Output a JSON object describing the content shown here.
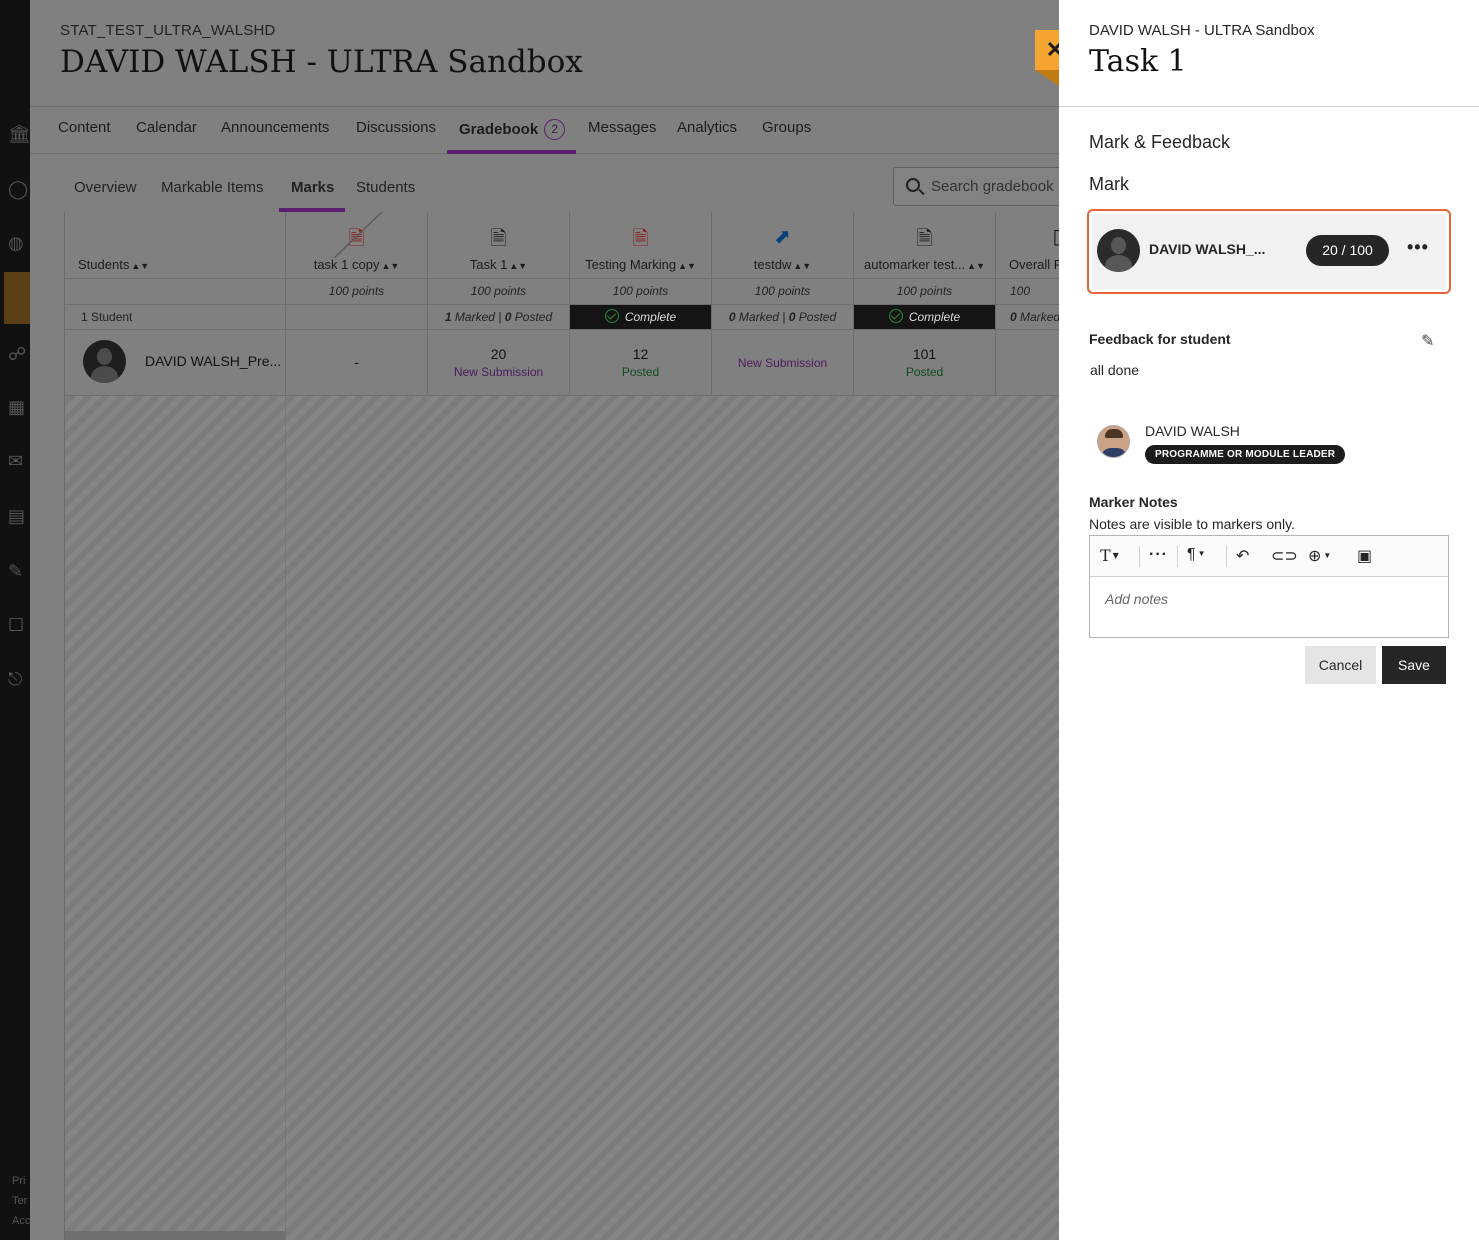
{
  "course": {
    "code": "STAT_TEST_ULTRA_WALSHD",
    "title": "DAVID WALSH - ULTRA Sandbox"
  },
  "top_tabs": [
    {
      "label": "Content"
    },
    {
      "label": "Calendar"
    },
    {
      "label": "Announcements"
    },
    {
      "label": "Discussions"
    },
    {
      "label": "Gradebook",
      "badge": "2",
      "active": true
    },
    {
      "label": "Messages"
    },
    {
      "label": "Analytics"
    },
    {
      "label": "Groups"
    }
  ],
  "sub_tabs": [
    {
      "label": "Overview"
    },
    {
      "label": "Markable Items"
    },
    {
      "label": "Marks",
      "active": true
    },
    {
      "label": "Students"
    }
  ],
  "search": {
    "placeholder": "Search gradebook"
  },
  "gradebook": {
    "students_header": "Students",
    "student_count": "1 Student",
    "columns": [
      {
        "title": "task 1 copy",
        "icon": "hidden-assignment-icon",
        "points": "100 points",
        "stat": "",
        "value": "-",
        "status": ""
      },
      {
        "title": "Task 1",
        "icon": "assignment-icon",
        "points": "100 points",
        "stat_marked": "1",
        "stat_posted": "0",
        "value": "20",
        "status": "New Submission"
      },
      {
        "title": "Testing Marking",
        "icon": "assignment-icon",
        "points": "100 points",
        "stat_complete": "Complete",
        "value": "12",
        "status": "Posted"
      },
      {
        "title": "testdw",
        "icon": "external-link-icon",
        "points": "100 points",
        "stat_marked": "0",
        "stat_posted": "0",
        "value": "",
        "status": "New Submission"
      },
      {
        "title": "automarker test...",
        "icon": "assignment-icon",
        "points": "100 points",
        "stat_complete": "Complete",
        "value": "101",
        "status": "Posted"
      },
      {
        "title": "Overall F",
        "icon": "grade-icon",
        "points": "100",
        "stat_marked": "0",
        "value": "",
        "status": ""
      }
    ],
    "stat_labels": {
      "marked": "Marked",
      "posted": "Posted",
      "separator": "|"
    },
    "student": {
      "name": "DAVID WALSH_Pre..."
    }
  },
  "panel": {
    "course_title": "DAVID WALSH - ULTRA Sandbox",
    "item_title": "Task 1",
    "section_title": "Mark & Feedback",
    "mark_label": "Mark",
    "student_name": "DAVID WALSH_...",
    "score": "20",
    "score_sep": "/",
    "score_max": "100",
    "feedback_label": "Feedback for student",
    "feedback_text": "all done",
    "marker_name": "DAVID WALSH",
    "marker_role": "PROGRAMME OR MODULE LEADER",
    "notes_label": "Marker Notes",
    "notes_sub": "Notes are visible to markers only.",
    "notes_placeholder": "Add notes",
    "cancel_label": "Cancel",
    "save_label": "Save"
  },
  "footer_fragments": [
    "Pri",
    "Ter",
    "Acc"
  ],
  "colors": {
    "accent": "#5c1f6e",
    "close": "#f4a531",
    "focus": "#e8643a"
  }
}
